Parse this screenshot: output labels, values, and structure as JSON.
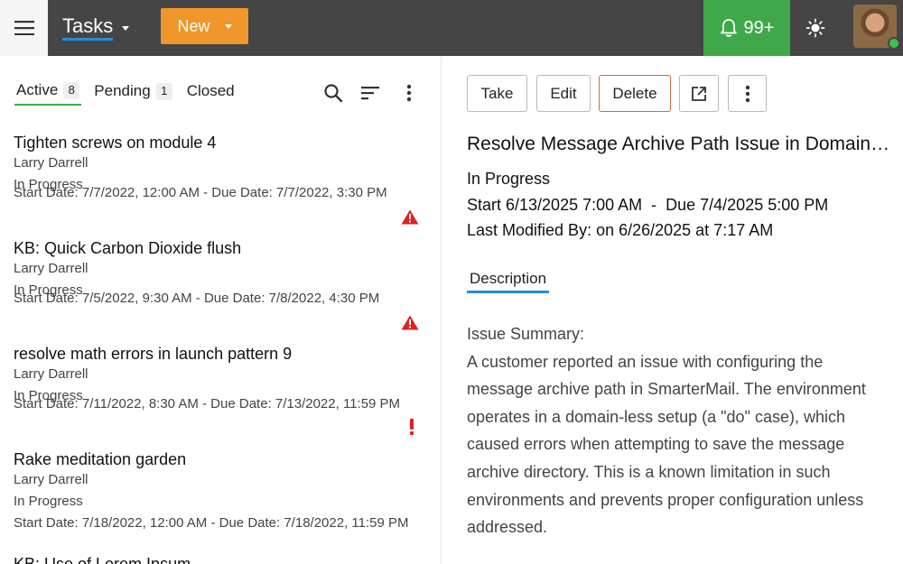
{
  "header": {
    "app_title": "Tasks",
    "new_label": "New",
    "notification_count": "99+",
    "icons": {
      "menu": "hamburger-icon",
      "bell": "bell-icon",
      "theme": "sun-icon",
      "avatar": "user-avatar"
    }
  },
  "colors": {
    "topbar": "#454545",
    "new_button": "#f0962a",
    "notification": "#3fa84a",
    "tab_underline": "#3fa84a",
    "link_underline": "#2a8bd6",
    "danger_border": "#d3693e",
    "warning_red": "#e02020"
  },
  "tabs": [
    {
      "label": "Active",
      "count": "8"
    },
    {
      "label": "Pending",
      "count": "1"
    },
    {
      "label": "Closed",
      "count": ""
    }
  ],
  "tools": [
    "search-icon",
    "sort-icon",
    "more-vertical-icon"
  ],
  "tasks": [
    {
      "title": "Tighten screws on module 4",
      "owner": "Larry Darrell",
      "status": "In Progress",
      "dates": "Start Date: 7/7/2022, 12:00 AM - Due Date: 7/7/2022, 3:30 PM",
      "flag": "warning-triangle-icon"
    },
    {
      "title": "KB: Quick Carbon Dioxide flush",
      "owner": "Larry Darrell",
      "status": "In Progress",
      "dates": "Start Date: 7/5/2022, 9:30 AM - Due Date: 7/8/2022, 4:30 PM",
      "flag": "warning-triangle-icon"
    },
    {
      "title": "resolve math errors in launch pattern 9",
      "owner": "Larry Darrell",
      "status": "In Progress",
      "dates": "Start Date: 7/11/2022, 8:30 AM - Due Date: 7/13/2022, 11:59 PM",
      "flag": "exclamation-icon"
    },
    {
      "title": "Rake meditation garden",
      "owner": "Larry Darrell",
      "status": "In Progress",
      "dates": "Start Date: 7/18/2022, 12:00 AM - Due Date: 7/18/2022, 11:59 PM",
      "flag": ""
    },
    {
      "title": "KB: Use of Lorem Ipsum",
      "owner": "",
      "status": "",
      "dates": "",
      "flag": ""
    }
  ],
  "actions": {
    "take": "Take",
    "edit": "Edit",
    "delete": "Delete",
    "open_external_icon": "external-link-icon",
    "more_icon": "more-vertical-icon"
  },
  "detail": {
    "title": "Resolve Message Archive Path Issue in Domain-less Environment",
    "status": "In Progress",
    "schedule": "Start 6/13/2025 7:00 AM  -  Due 7/4/2025 5:00 PM",
    "modified": "Last Modified By: on 6/26/2025 at 7:17 AM",
    "description_tab": "Description",
    "summary_heading": "Issue Summary:",
    "summary_text": "A customer reported an issue with configuring the message archive path in SmarterMail. The environment operates in a domain-less setup (a \"do\" case), which caused errors when attempting to save the message archive directory. This is a known limitation in such environments and prevents proper configuration unless addressed."
  }
}
